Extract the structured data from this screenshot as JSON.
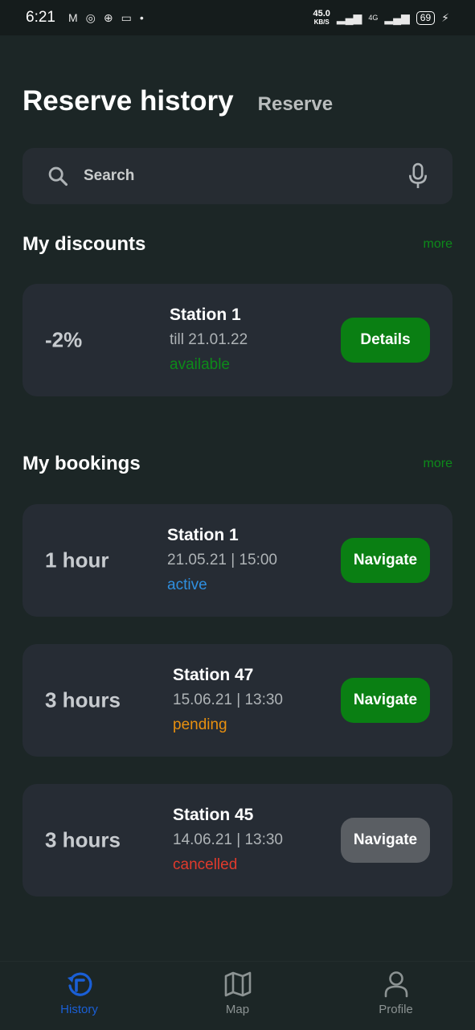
{
  "statusbar": {
    "time": "6:21",
    "speed_value": "45.0",
    "speed_unit": "KB/S",
    "network": "4G",
    "battery": "69"
  },
  "header": {
    "title": "Reserve history",
    "subtitle": "Reserve"
  },
  "search": {
    "placeholder": "Search"
  },
  "discounts": {
    "title": "My discounts",
    "more": "more",
    "items": [
      {
        "amount": "-2%",
        "station": "Station 1",
        "date": "till 21.01.22",
        "status": "available",
        "status_color": "#0d8a1a",
        "button": "Details"
      }
    ]
  },
  "bookings": {
    "title": "My bookings",
    "more": "more",
    "items": [
      {
        "duration": "1 hour",
        "station": "Station 1",
        "datetime": "21.05.21 | 15:00",
        "status": "active",
        "status_color": "#2f8fe0",
        "button": "Navigate",
        "button_enabled": true
      },
      {
        "duration": "3 hours",
        "station": "Station 47",
        "datetime": "15.06.21 | 13:30",
        "status": "pending",
        "status_color": "#e8900f",
        "button": "Navigate",
        "button_enabled": true
      },
      {
        "duration": "3 hours",
        "station": "Station 45",
        "datetime": "14.06.21 | 13:30",
        "status": "cancelled",
        "status_color": "#e03a2c",
        "button": "Navigate",
        "button_enabled": false
      }
    ]
  },
  "nav": {
    "items": [
      {
        "label": "History",
        "icon": "history-icon",
        "active": true
      },
      {
        "label": "Map",
        "icon": "map-icon",
        "active": false
      },
      {
        "label": "Profile",
        "icon": "profile-icon",
        "active": false
      }
    ]
  },
  "colors": {
    "accent_green": "#0a7f13",
    "nav_active": "#1a5fd6",
    "background": "#1c2626",
    "card": "#262c34"
  }
}
